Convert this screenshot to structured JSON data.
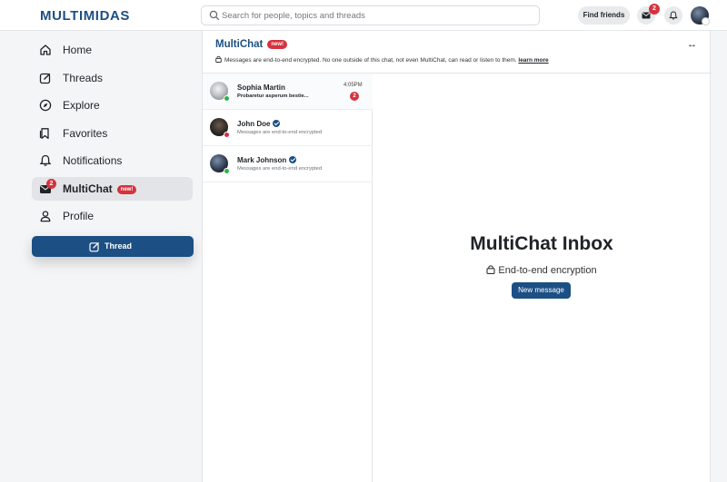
{
  "app": {
    "logo": "MULTIMIDAS"
  },
  "search": {
    "placeholder": "Search for people, topics and threads"
  },
  "header": {
    "find_friends": "Find friends",
    "mail_badge": "2",
    "icons": [
      "search-icon",
      "mail-icon",
      "bell-icon",
      "avatar"
    ]
  },
  "sidebar": {
    "items": [
      {
        "label": "Home",
        "icon": "home-icon"
      },
      {
        "label": "Threads",
        "icon": "edit-icon"
      },
      {
        "label": "Explore",
        "icon": "compass-icon"
      },
      {
        "label": "Favorites",
        "icon": "bookmark-icon"
      },
      {
        "label": "Notifications",
        "icon": "bell-icon"
      },
      {
        "label": "MultiChat",
        "icon": "mail-icon",
        "badge": "2",
        "pill": "new!",
        "active": true
      },
      {
        "label": "Profile",
        "icon": "user-icon"
      }
    ],
    "thread_button": "Thread"
  },
  "chat": {
    "title": "MultiChat",
    "title_pill": "new!",
    "expand_icon": "↔",
    "encryption_note": "Messages are end-to-end encrypted. No one outside of this chat, not even MultiChat, can read or listen to them.",
    "learn_more": "learn more",
    "conversations": [
      {
        "name": "Sophia Martin",
        "preview": "Probaretur asperum bestie...",
        "time": "4:05PM",
        "unread": "2",
        "status": "online",
        "verified": false
      },
      {
        "name": "John Doe",
        "preview": "Messages are end-to-end encrypted",
        "time": "",
        "unread": "",
        "status": "busy",
        "verified": true
      },
      {
        "name": "Mark Johnson",
        "preview": "Messages are end-to-end encrypted",
        "time": "",
        "unread": "",
        "status": "online",
        "verified": true
      }
    ],
    "inbox": {
      "title": "MultiChat Inbox",
      "subtitle": "End-to-end encryption",
      "new_message": "New message"
    }
  },
  "colors": {
    "brand": "#1c4f84",
    "badge": "#d6323e",
    "online": "#2fb344",
    "busy": "#d6323e"
  }
}
